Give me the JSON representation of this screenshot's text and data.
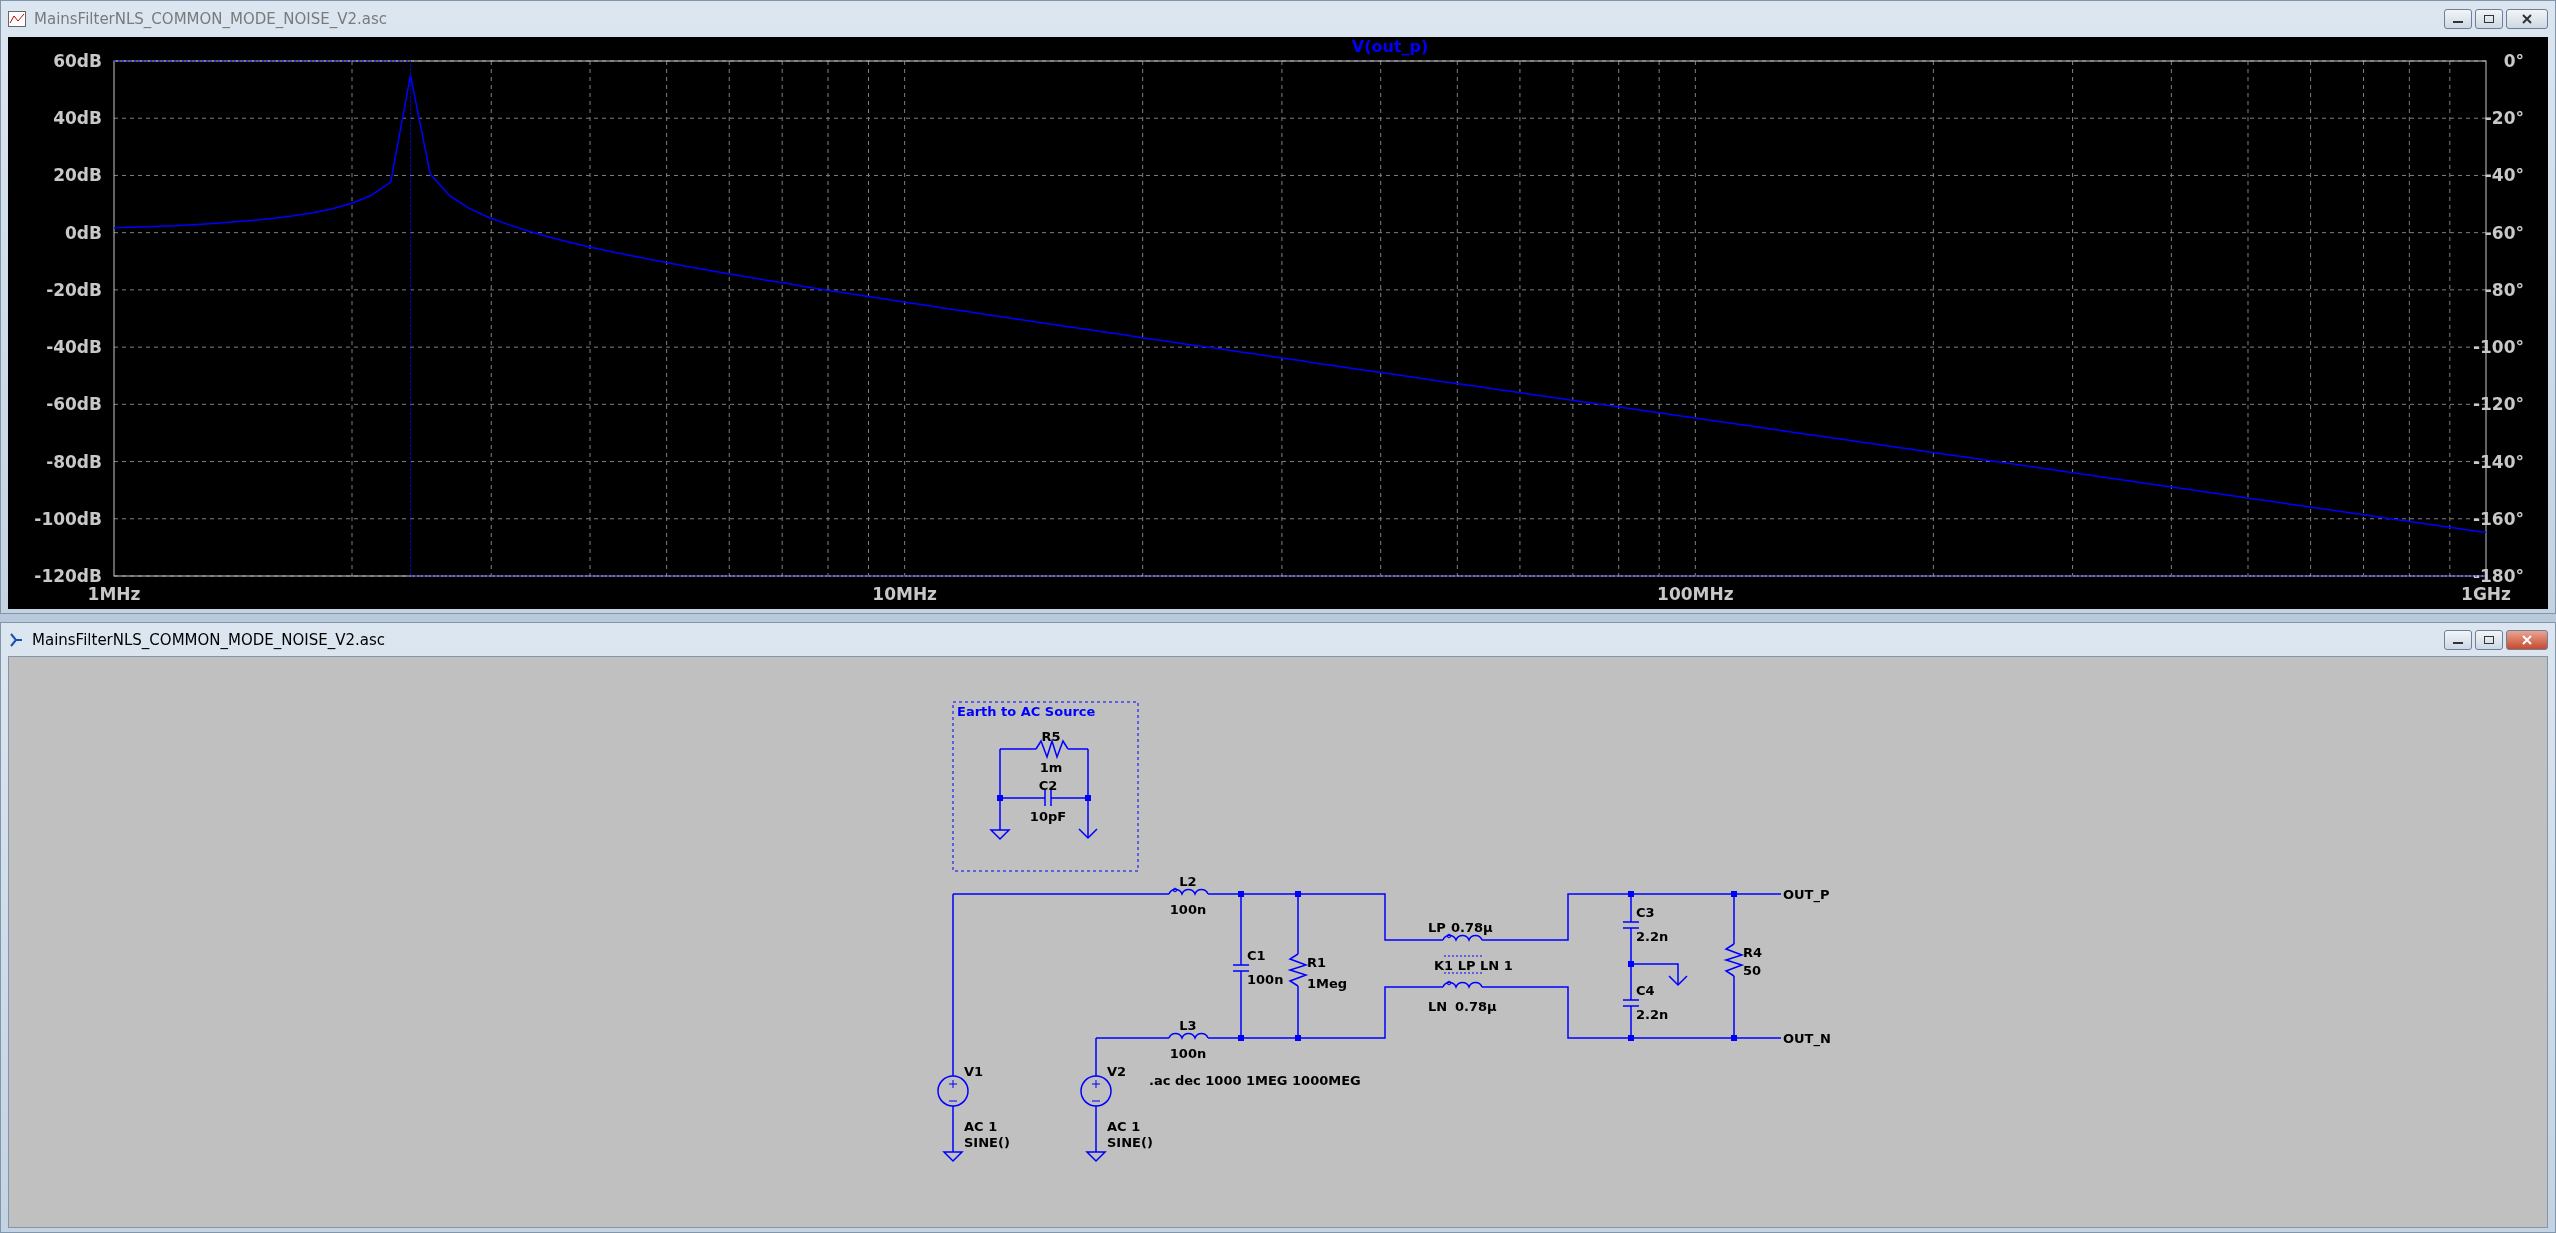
{
  "plot_window": {
    "title": "MainsFilterNLS_COMMON_MODE_NOISE_V2.asc",
    "active": false,
    "plot": {
      "phase_ticks": [
        "0°",
        "-20°",
        "-40°",
        "-60°",
        "-80°",
        "-100°",
        "-120°",
        "-140°",
        "-160°",
        "-180°"
      ],
      "chart_data": {
        "type": "line",
        "categories": [
          "1MHz",
          null,
          null,
          null,
          null,
          null,
          null,
          null,
          null,
          null,
          null,
          null,
          null,
          null,
          null,
          null,
          null,
          null,
          null,
          null,
          null,
          null,
          null,
          null,
          null,
          null,
          null,
          null,
          null,
          null,
          null,
          null,
          null,
          null,
          null,
          null,
          null,
          null,
          null,
          null,
          "10MHz",
          null,
          null,
          null,
          null,
          null,
          null,
          null,
          null,
          null,
          null,
          null,
          null,
          null,
          null,
          null,
          null,
          null,
          null,
          null,
          null,
          null,
          null,
          null,
          null,
          null,
          null,
          null,
          null,
          null,
          null,
          null,
          null,
          null,
          null,
          null,
          null,
          null,
          null,
          null,
          "100MHz",
          null,
          null,
          null,
          null,
          null,
          null,
          null,
          null,
          null,
          null,
          null,
          null,
          null,
          null,
          null,
          null,
          null,
          null,
          null,
          null,
          null,
          null,
          null,
          null,
          null,
          null,
          null,
          null,
          null,
          null,
          null,
          null,
          null,
          null,
          null,
          null,
          null,
          null,
          null,
          "1GHz"
        ],
        "series": [
          {
            "name": "V(out_p)",
            "color": "#0000ff",
            "values": [
              1.7,
              1.9,
              2.2,
              2.4,
              2.8,
              3.2,
              3.7,
              4.3,
              5.0,
              5.8,
              6.9,
              8.3,
              10.2,
              13.0,
              17.7,
              55,
              20.4,
              12.8,
              8.4,
              5.2,
              2.7,
              0.5,
              -1.5,
              -3.3,
              -4.9,
              -6.4,
              -7.8,
              -9.2,
              -10.5,
              -11.8,
              -13.1,
              -14.3,
              -15.4,
              -16.6,
              -17.7,
              -18.9,
              -20.0,
              -21.1,
              -22.1,
              -23.2,
              -24.3,
              -25.3,
              -26.4,
              -27.4,
              -28.5,
              -29.5,
              -30.5,
              -31.6,
              -32.6,
              -33.6,
              -34.6,
              -35.6,
              -36.7,
              -37.7,
              -38.7,
              -39.7,
              -40.7,
              -41.7,
              -42.7,
              -43.7,
              -44.7,
              -45.8,
              -46.8,
              -47.8,
              -48.8,
              -49.8,
              -50.8,
              -51.8,
              -52.8,
              -53.8,
              -54.8,
              -55.8,
              -56.8,
              -57.8,
              -58.8,
              -59.8,
              -60.8,
              -61.8,
              -62.8,
              -63.8,
              -64.8,
              -65.8,
              -66.8,
              -67.8,
              -68.8,
              -69.8,
              -70.8,
              -71.8,
              -72.8,
              -73.8,
              -74.8,
              -75.8,
              -76.8,
              -77.8,
              -78.8,
              -79.8,
              -80.8,
              -81.8,
              -82.8,
              -83.8,
              -84.8,
              -85.8,
              -86.8,
              -87.8,
              -88.8,
              -89.8,
              -90.8,
              -91.8,
              -92.8,
              -93.8,
              -94.8,
              -95.8,
              -96.8,
              -97.8,
              -98.8,
              -99.8,
              -100.8,
              -101.8,
              -102.8,
              -103.8,
              -104.8
            ]
          }
        ],
        "ylim": [
          -120,
          60
        ],
        "grid": true,
        "yticks": [
          {
            "value": 60,
            "label": "60dB"
          },
          {
            "value": 40,
            "label": "40dB"
          },
          {
            "value": 20,
            "label": "20dB"
          },
          {
            "value": 0,
            "label": "0dB"
          },
          {
            "value": -20,
            "label": "-20dB"
          },
          {
            "value": -40,
            "label": "-40dB"
          },
          {
            "value": -60,
            "label": "-60dB"
          },
          {
            "value": -80,
            "label": "-80dB"
          },
          {
            "value": -100,
            "label": "-100dB"
          },
          {
            "value": -120,
            "label": "-120dB"
          }
        ]
      }
    }
  },
  "schematic_window": {
    "title": "MainsFilterNLS_COMMON_MODE_NOISE_V2.asc",
    "active": true,
    "schematic": {
      "group_label": "Earth to AC Source",
      "components": [
        {
          "kind": "resistor",
          "name": "R5",
          "value": [
            "1m"
          ]
        },
        {
          "kind": "capacitor",
          "name": "C2",
          "value": [
            "10pF"
          ]
        },
        {
          "kind": "inductor",
          "name": "L2",
          "value": [
            "100n"
          ]
        },
        {
          "kind": "inductor",
          "name": "L3",
          "value": [
            "100n"
          ]
        },
        {
          "kind": "capacitor",
          "name": "C1",
          "value": [
            "100n"
          ]
        },
        {
          "kind": "resistor",
          "name": "R1",
          "value": [
            "1Meg"
          ]
        },
        {
          "kind": "inductor",
          "name": "LP",
          "value": [
            "0.78µ"
          ]
        },
        {
          "kind": "inductor",
          "name": "LN",
          "value": [
            "0.78µ"
          ]
        },
        {
          "kind": "capacitor",
          "name": "C3",
          "value": [
            "2.2n"
          ]
        },
        {
          "kind": "capacitor",
          "name": "C4",
          "value": [
            "2.2n"
          ]
        },
        {
          "kind": "resistor",
          "name": "R4",
          "value": [
            "50"
          ]
        },
        {
          "kind": "voltage_source",
          "name": "V1",
          "value": [
            "AC 1",
            "SINE()"
          ]
        },
        {
          "kind": "voltage_source",
          "name": "V2",
          "value": [
            "AC 1",
            "SINE()"
          ]
        }
      ],
      "coupling": "K1 LP LN 1",
      "directive": ".ac dec 1000 1MEG 1000MEG",
      "net_labels": [
        "OUT_P",
        "OUT_N"
      ]
    }
  }
}
